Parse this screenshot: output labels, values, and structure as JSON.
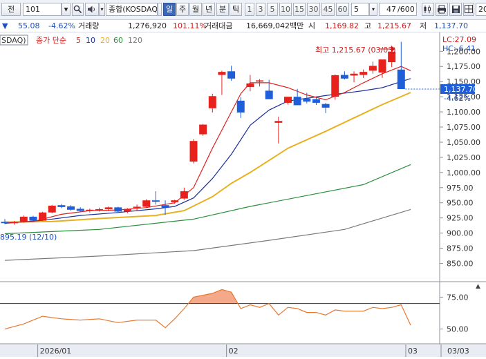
{
  "toolbar": {
    "prefix_label": "전",
    "code_value": "101",
    "name_value": "종합(KOSDAQ)",
    "period_tabs": [
      {
        "label": "일",
        "selected": true
      },
      {
        "label": "주",
        "selected": false
      },
      {
        "label": "월",
        "selected": false
      },
      {
        "label": "년",
        "selected": false
      },
      {
        "label": "분",
        "selected": false
      },
      {
        "label": "틱",
        "selected": false
      }
    ],
    "interval_buttons": [
      "1",
      "3",
      "5",
      "10",
      "15",
      "30",
      "45",
      "60"
    ],
    "interval_value": "5",
    "count_value": "47",
    "count_total": "/600",
    "date_value": "20"
  },
  "quote": {
    "change_arrow": "▼",
    "change": "55.08",
    "change_pct": "-4.62%",
    "volume_label": "거래량",
    "volume": "1,276,920",
    "volume_ratio": "101.11%",
    "amount_label": "거래대금",
    "amount": "16,669,042백만",
    "open_label": "시",
    "open": "1,169.82",
    "high_label": "고",
    "high": "1,215.67",
    "low_label": "저",
    "low": "1,137.70"
  },
  "chart": {
    "name_partial": "SDAQ)",
    "legend_prefix": "종가 단순",
    "ma_legend": [
      {
        "label": "5",
        "color": "#e02020"
      },
      {
        "label": "10",
        "color": "#1a2f9e"
      },
      {
        "label": "20",
        "color": "#e8b020"
      },
      {
        "label": "60",
        "color": "#2a8f3a"
      },
      {
        "label": "120",
        "color": "#7a7a7a"
      }
    ],
    "max_annotation": "최고 1,215.67 (03/03)",
    "min_annotation": "895.19 (12/10)",
    "lc_label": "LC:27.09",
    "hc_label": "HC:-6.41",
    "current_price": "1,137.70",
    "current_change": "-4.62%",
    "y_ticks": [
      "1,200.00",
      "1,175.00",
      "1,150.00",
      "1,125.00",
      "1,100.00",
      "1,075.00",
      "1,050.00",
      "1,025.00",
      "1,000.00",
      "975.00",
      "950.00",
      "925.00",
      "900.00",
      "875.00",
      "850.00"
    ],
    "x_labels": [
      {
        "label": "2026/01",
        "index": 4
      },
      {
        "label": "02",
        "index": 24
      },
      {
        "label": "03",
        "index": 43
      }
    ],
    "date_box": "03/03",
    "rsi_ticks": [
      "75.00",
      "50.00"
    ],
    "colors": {
      "up": "#e8211c",
      "down": "#1e5ed8",
      "rsi_fill": "#f4a98a",
      "rsi_line": "#e8772e"
    }
  },
  "chart_data": {
    "type": "candlestick",
    "y_range": [
      838,
      1222
    ],
    "rsi_range": [
      40,
      85
    ],
    "rsi_reference": 70,
    "candles": [
      {
        "o": 918.6,
        "h": 923.0,
        "l": 914.6,
        "c": 916.3
      },
      {
        "o": 916.3,
        "h": 920.0,
        "l": 913.8,
        "c": 918.4
      },
      {
        "o": 919.0,
        "h": 929.0,
        "l": 917.0,
        "c": 927.0
      },
      {
        "o": 927.0,
        "h": 928.5,
        "l": 919.0,
        "c": 920.5
      },
      {
        "o": 920.5,
        "h": 935.0,
        "l": 919.6,
        "c": 934.0
      },
      {
        "o": 934.0,
        "h": 946.5,
        "l": 932.5,
        "c": 945.2
      },
      {
        "o": 946.0,
        "h": 948.0,
        "l": 941.0,
        "c": 943.0
      },
      {
        "o": 944.0,
        "h": 946.0,
        "l": 937.0,
        "c": 938.5
      },
      {
        "o": 940.0,
        "h": 942.5,
        "l": 934.5,
        "c": 936.6
      },
      {
        "o": 937.0,
        "h": 940.3,
        "l": 934.0,
        "c": 938.5
      },
      {
        "o": 938.5,
        "h": 942.0,
        "l": 935.5,
        "c": 939.5
      },
      {
        "o": 939.5,
        "h": 944.0,
        "l": 936.0,
        "c": 942.4
      },
      {
        "o": 942.4,
        "h": 943.5,
        "l": 934.0,
        "c": 935.5
      },
      {
        "o": 935.5,
        "h": 941.0,
        "l": 933.0,
        "c": 940.0
      },
      {
        "o": 941.5,
        "h": 947.0,
        "l": 936.0,
        "c": 943.5
      },
      {
        "o": 943.5,
        "h": 956.0,
        "l": 942.0,
        "c": 954.0
      },
      {
        "o": 954.0,
        "h": 969.0,
        "l": 947.0,
        "c": 951.7
      },
      {
        "o": 946.0,
        "h": 954.0,
        "l": 930.0,
        "c": 942.0
      },
      {
        "o": 951.0,
        "h": 955.0,
        "l": 948.5,
        "c": 954.0
      },
      {
        "o": 957.0,
        "h": 975.0,
        "l": 955.0,
        "c": 969.0
      },
      {
        "o": 1018.0,
        "h": 1055.0,
        "l": 1015.0,
        "c": 1052.0
      },
      {
        "o": 1063.0,
        "h": 1080.0,
        "l": 1060.5,
        "c": 1079.0
      },
      {
        "o": 1106.0,
        "h": 1130.0,
        "l": 1099.0,
        "c": 1126.0
      },
      {
        "o": 1161.0,
        "h": 1168.0,
        "l": 1128.0,
        "c": 1166.0
      },
      {
        "o": 1167.0,
        "h": 1176.0,
        "l": 1151.5,
        "c": 1155.0
      },
      {
        "o": 1118.5,
        "h": 1124.5,
        "l": 1090.0,
        "c": 1099.0
      },
      {
        "o": 1141.0,
        "h": 1161.0,
        "l": 1134.0,
        "c": 1147.0
      },
      {
        "o": 1150.0,
        "h": 1154.0,
        "l": 1142.0,
        "c": 1152.0
      },
      {
        "o": 1135.0,
        "h": 1153.0,
        "l": 1123.0,
        "c": 1121.0
      },
      {
        "o": 1082.0,
        "h": 1092.0,
        "l": 1048.0,
        "c": 1085.0
      },
      {
        "o": 1115.0,
        "h": 1125.0,
        "l": 1112.0,
        "c": 1125.0
      },
      {
        "o": 1125.0,
        "h": 1138.0,
        "l": 1118.0,
        "c": 1111.0
      },
      {
        "o": 1122.0,
        "h": 1131.5,
        "l": 1114.0,
        "c": 1117.0
      },
      {
        "o": 1121.0,
        "h": 1125.5,
        "l": 1111.5,
        "c": 1115.0
      },
      {
        "o": 1113.0,
        "h": 1115.0,
        "l": 1098.0,
        "c": 1107.0
      },
      {
        "o": 1125.0,
        "h": 1162.0,
        "l": 1120.0,
        "c": 1160.5
      },
      {
        "o": 1161.0,
        "h": 1167.0,
        "l": 1153.5,
        "c": 1155.0
      },
      {
        "o": 1160.0,
        "h": 1167.0,
        "l": 1149.0,
        "c": 1163.0
      },
      {
        "o": 1161.0,
        "h": 1170.0,
        "l": 1156.0,
        "c": 1166.0
      },
      {
        "o": 1168.0,
        "h": 1183.0,
        "l": 1163.0,
        "c": 1176.0
      },
      {
        "o": 1165.0,
        "h": 1180.0,
        "l": 1156.0,
        "c": 1186.5
      },
      {
        "o": 1182.0,
        "h": 1199.0,
        "l": 1174.0,
        "c": 1199.5
      },
      {
        "o": 1169.8,
        "h": 1215.67,
        "l": 1137.7,
        "c": 1137.7
      }
    ],
    "ma5": [
      {
        "i": 0,
        "v": 917
      },
      {
        "i": 3,
        "v": 919
      },
      {
        "i": 6,
        "v": 931
      },
      {
        "i": 9,
        "v": 937
      },
      {
        "i": 12,
        "v": 938
      },
      {
        "i": 15,
        "v": 942
      },
      {
        "i": 18,
        "v": 950
      },
      {
        "i": 20,
        "v": 975
      },
      {
        "i": 22,
        "v": 1040
      },
      {
        "i": 24,
        "v": 1100
      },
      {
        "i": 25,
        "v": 1130
      },
      {
        "i": 26,
        "v": 1148
      },
      {
        "i": 28,
        "v": 1148
      },
      {
        "i": 30,
        "v": 1140
      },
      {
        "i": 32,
        "v": 1128
      },
      {
        "i": 34,
        "v": 1120
      },
      {
        "i": 36,
        "v": 1132
      },
      {
        "i": 38,
        "v": 1148
      },
      {
        "i": 40,
        "v": 1163
      },
      {
        "i": 42,
        "v": 1175
      },
      {
        "i": 43,
        "v": 1168
      }
    ],
    "ma10": [
      {
        "i": 0,
        "v": 916
      },
      {
        "i": 4,
        "v": 921
      },
      {
        "i": 8,
        "v": 929
      },
      {
        "i": 12,
        "v": 934
      },
      {
        "i": 16,
        "v": 940
      },
      {
        "i": 18,
        "v": 944
      },
      {
        "i": 20,
        "v": 958
      },
      {
        "i": 22,
        "v": 990
      },
      {
        "i": 24,
        "v": 1030
      },
      {
        "i": 26,
        "v": 1078
      },
      {
        "i": 28,
        "v": 1103
      },
      {
        "i": 30,
        "v": 1118
      },
      {
        "i": 34,
        "v": 1127
      },
      {
        "i": 38,
        "v": 1135
      },
      {
        "i": 40,
        "v": 1140
      },
      {
        "i": 43,
        "v": 1155
      }
    ],
    "ma20": [
      {
        "i": 0,
        "v": 918
      },
      {
        "i": 5,
        "v": 919
      },
      {
        "i": 10,
        "v": 924
      },
      {
        "i": 16,
        "v": 929
      },
      {
        "i": 19,
        "v": 937
      },
      {
        "i": 22,
        "v": 960
      },
      {
        "i": 24,
        "v": 982
      },
      {
        "i": 26,
        "v": 1000
      },
      {
        "i": 28,
        "v": 1020
      },
      {
        "i": 30,
        "v": 1040
      },
      {
        "i": 34,
        "v": 1068
      },
      {
        "i": 37,
        "v": 1090
      },
      {
        "i": 40,
        "v": 1112
      },
      {
        "i": 43,
        "v": 1132
      }
    ],
    "ma60": [
      {
        "i": 0,
        "v": 899
      },
      {
        "i": 10,
        "v": 906
      },
      {
        "i": 20,
        "v": 923
      },
      {
        "i": 26,
        "v": 944
      },
      {
        "i": 32,
        "v": 962
      },
      {
        "i": 38,
        "v": 980
      },
      {
        "i": 43,
        "v": 1013
      }
    ],
    "ma120": [
      {
        "i": 0,
        "v": 855
      },
      {
        "i": 10,
        "v": 862
      },
      {
        "i": 20,
        "v": 871
      },
      {
        "i": 28,
        "v": 888
      },
      {
        "i": 36,
        "v": 906
      },
      {
        "i": 43,
        "v": 939
      }
    ],
    "rsi": [
      {
        "i": 0,
        "v": 50
      },
      {
        "i": 2,
        "v": 54
      },
      {
        "i": 4,
        "v": 60
      },
      {
        "i": 6,
        "v": 58
      },
      {
        "i": 8,
        "v": 57
      },
      {
        "i": 10,
        "v": 58
      },
      {
        "i": 12,
        "v": 55
      },
      {
        "i": 14,
        "v": 57
      },
      {
        "i": 16,
        "v": 57
      },
      {
        "i": 17,
        "v": 51
      },
      {
        "i": 18,
        "v": 58
      },
      {
        "i": 19,
        "v": 66
      },
      {
        "i": 20,
        "v": 75
      },
      {
        "i": 22,
        "v": 78
      },
      {
        "i": 23,
        "v": 81
      },
      {
        "i": 24,
        "v": 79
      },
      {
        "i": 25,
        "v": 66
      },
      {
        "i": 26,
        "v": 69
      },
      {
        "i": 27,
        "v": 67
      },
      {
        "i": 28,
        "v": 70
      },
      {
        "i": 29,
        "v": 61
      },
      {
        "i": 30,
        "v": 67
      },
      {
        "i": 31,
        "v": 66
      },
      {
        "i": 32,
        "v": 63
      },
      {
        "i": 33,
        "v": 63
      },
      {
        "i": 34,
        "v": 61
      },
      {
        "i": 35,
        "v": 65
      },
      {
        "i": 36,
        "v": 64
      },
      {
        "i": 37,
        "v": 64
      },
      {
        "i": 38,
        "v": 64
      },
      {
        "i": 39,
        "v": 67
      },
      {
        "i": 40,
        "v": 66
      },
      {
        "i": 41,
        "v": 67
      },
      {
        "i": 42,
        "v": 69
      },
      {
        "i": 43,
        "v": 53
      }
    ]
  }
}
